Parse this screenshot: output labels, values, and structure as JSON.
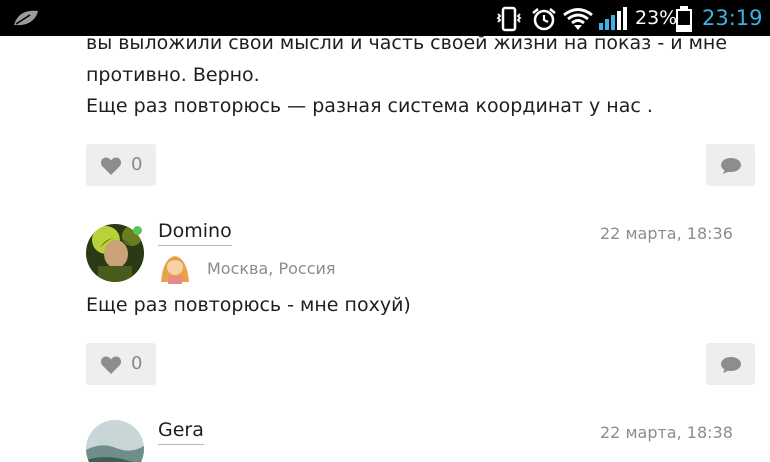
{
  "status_bar": {
    "battery_percent": "23%",
    "time": "23:19"
  },
  "post_tail": {
    "line1": "вы выложили свои мысли и часть своей жизни на показ  -  и мне",
    "line2": "противно. Верно.",
    "line3": "Еще раз повторюсь — разная система координат у нас ."
  },
  "comments": [
    {
      "likes": "0"
    },
    {
      "author": "Domino",
      "date": "22 марта, 18:36",
      "location": "Москва, Россия",
      "text": "Еще раз повторюсь - мне похуй)",
      "likes": "0"
    },
    {
      "author": "Gera",
      "date": "22 марта, 18:38"
    }
  ],
  "colors": {
    "clock": "#3bb3e6",
    "online": "#5cc45c",
    "button_bg": "#eeeeee"
  },
  "icons": [
    "leaf-icon",
    "vibrate-icon",
    "alarm-icon",
    "wifi-icon",
    "signal-icon",
    "battery-icon",
    "heart-icon",
    "comment-icon"
  ]
}
